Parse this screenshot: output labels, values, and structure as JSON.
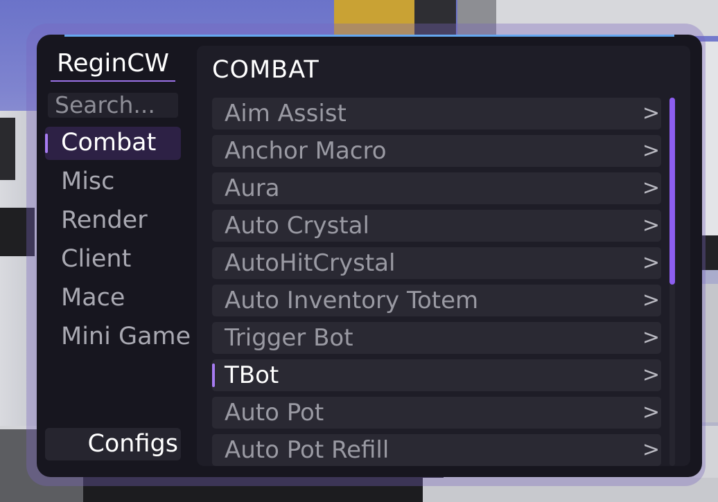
{
  "app": {
    "brand": "ReginCW"
  },
  "search": {
    "placeholder": "Search..."
  },
  "categories": [
    {
      "label": "Combat",
      "active": true
    },
    {
      "label": "Misc"
    },
    {
      "label": "Render"
    },
    {
      "label": "Client"
    },
    {
      "label": "Mace"
    },
    {
      "label": "Mini Game"
    }
  ],
  "configs_label": "Configs",
  "main": {
    "title": "COMBAT",
    "modules": [
      {
        "name": "Aim Assist",
        "arrow": ">"
      },
      {
        "name": "Anchor Macro",
        "arrow": ">"
      },
      {
        "name": "Aura",
        "arrow": ">"
      },
      {
        "name": "Auto Crystal",
        "arrow": ">"
      },
      {
        "name": "AutoHitCrystal",
        "arrow": ">"
      },
      {
        "name": "Auto Inventory Totem",
        "arrow": ">"
      },
      {
        "name": "Trigger Bot",
        "arrow": ">"
      },
      {
        "name": "TBot",
        "arrow": ">",
        "active": true
      },
      {
        "name": "Auto Pot",
        "arrow": ">"
      },
      {
        "name": "Auto Pot Refill",
        "arrow": ">"
      }
    ]
  },
  "colors": {
    "accent": "#a77cf2",
    "scrollbar": "#8d5ef0",
    "top_line": "#66a8f0",
    "panel_bg": "#17161f"
  }
}
